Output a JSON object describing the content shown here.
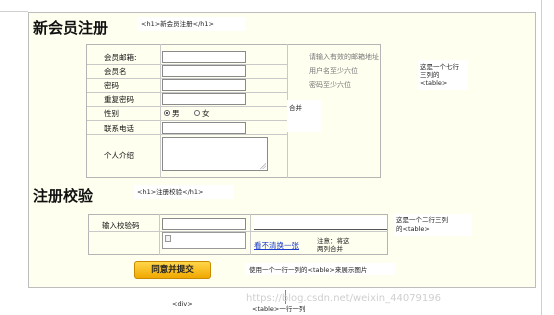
{
  "heading_register": "新会员注册",
  "note_h1_register": "<h1>新会员注册</h1>",
  "form": {
    "email_label": "会员邮箱:",
    "username_label": "会员名",
    "password_label": "密码",
    "repeat_password_label": "重复密码",
    "gender_label": "性别",
    "gender_male": "男",
    "gender_female": "女",
    "phone_label": "联系电话",
    "intro_label": "个人介绍",
    "email_hint": "请输入有效的邮箱地址",
    "username_hint": "用户名至少六位",
    "password_hint": "密码至少六位",
    "merge_note": "合并"
  },
  "note_table7": [
    "这是一个七行",
    "三列的",
    "<table>"
  ],
  "heading_verify": "注册校验",
  "note_h1_verify": "<h1>注册校验</h1>",
  "verify": {
    "code_label": "输入校验码",
    "refresh_link": "看不清换一张",
    "merge_note": [
      "注意：将这",
      "两列合并"
    ]
  },
  "note_table2": [
    "这是一个二行三列",
    "的<table>"
  ],
  "submit_label": "同意并提交",
  "note_image_table": "使用一个一行一列的<table>来展示图片",
  "note_div": "<div>",
  "note_table1": "<table>一行一列",
  "watermark": "https://blog.csdn.net/weixin_44079196"
}
